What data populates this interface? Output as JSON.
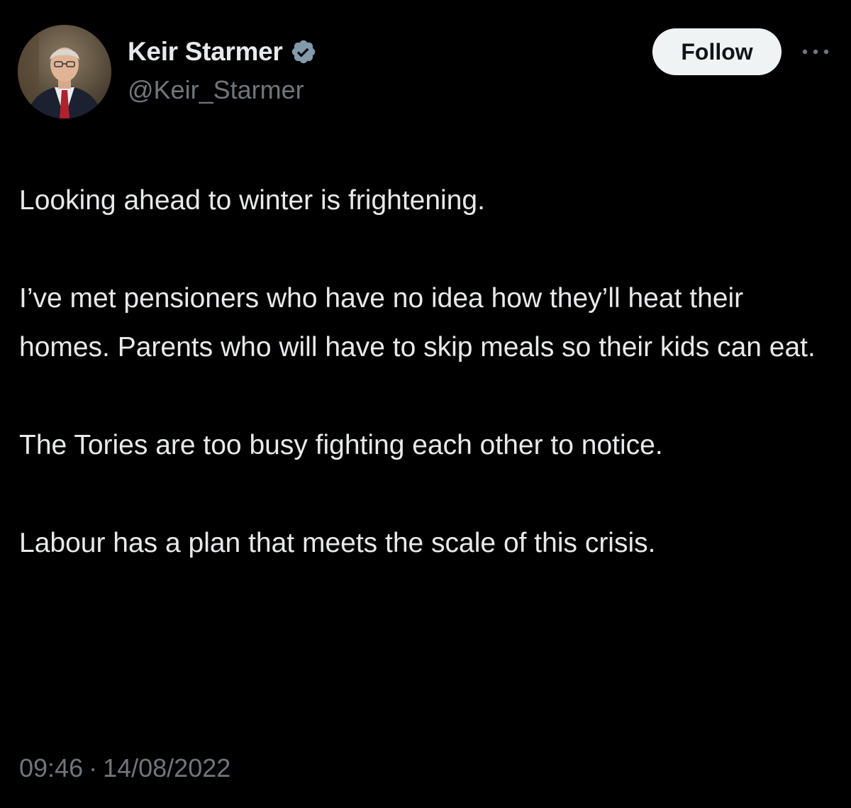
{
  "author": {
    "display_name": "Keir Starmer",
    "handle": "@Keir_Starmer",
    "verified_icon": "verified-badge-icon",
    "avatar_icon": "avatar"
  },
  "actions": {
    "follow_label": "Follow",
    "more_icon": "more-options-icon"
  },
  "tweet": {
    "paragraphs": [
      "Looking ahead to winter is frightening.",
      "I’ve met pensioners who have no idea how they’ll heat their homes. Parents who will have to skip meals so their kids can eat.",
      "The Tories are too busy fighting each other to notice.",
      "Labour has a plan that meets the scale of this crisis."
    ],
    "time": "09:46",
    "separator": "·",
    "date": "14/08/2022"
  },
  "colors": {
    "background": "#000000",
    "text_primary": "#e7e9ea",
    "text_secondary": "#71767b",
    "verified": "#829aab",
    "follow_bg": "#eff3f4"
  }
}
